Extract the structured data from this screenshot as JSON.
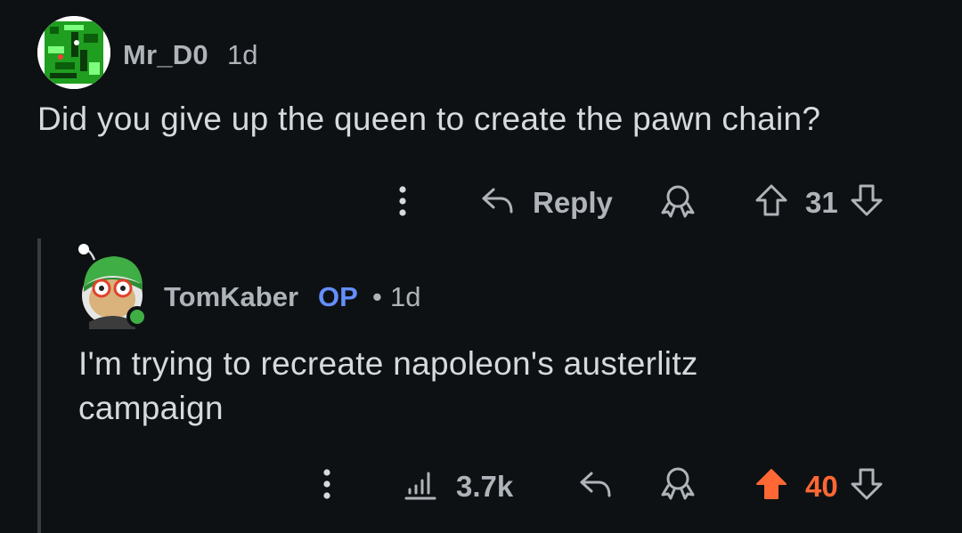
{
  "comment1": {
    "username": "Mr_D0",
    "time": "1d",
    "body": "Did you give up the queen to create the pawn chain?",
    "actions": {
      "reply_label": "Reply",
      "score": "31"
    }
  },
  "comment2": {
    "username": "TomKaber",
    "op_badge": "OP",
    "separator": "•",
    "time": "1d",
    "body_line1": "I'm trying to recreate napoleon's austerlitz",
    "body_line2": "campaign",
    "actions": {
      "views": "3.7k",
      "score": "40"
    }
  },
  "colors": {
    "background": "#0e1113",
    "text": "#d7dadc",
    "muted": "#aeb4b9",
    "op_blue": "#648efc",
    "upvote_orange": "#ff6734"
  },
  "icons": [
    "more-vertical-icon",
    "reply-icon",
    "award-icon",
    "upvote-icon",
    "downvote-icon",
    "insights-icon"
  ]
}
